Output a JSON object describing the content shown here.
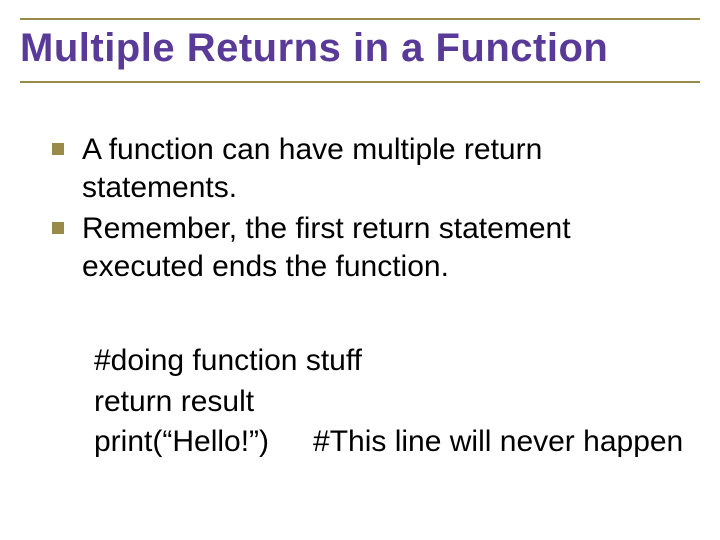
{
  "title": "Multiple Returns in a Function",
  "bullets": [
    "A function can have multiple return statements.",
    "Remember, the first return statement executed ends the function."
  ],
  "code": {
    "line1": "#doing function stuff",
    "line2": "return result",
    "line3_left": "print(“Hello!”)",
    "line3_right": "#This line will never happen"
  }
}
